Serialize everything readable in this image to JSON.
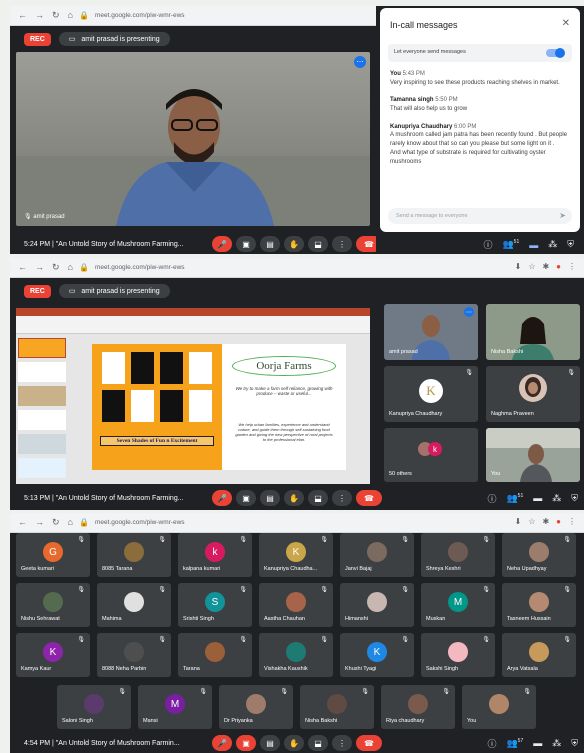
{
  "colors": {
    "meet_dark": "#202124",
    "tile": "#3c4043",
    "rec_red": "#ea4335",
    "accent_blue": "#1a73e8"
  },
  "browser": {
    "url": "meet.google.com/piw-wmr-ews"
  },
  "meet": {
    "rec_label": "REC",
    "presenting_text": "amit prasad is presenting",
    "meeting_title": "\"An Untold Story of Mushroom Farming...",
    "meeting_title_short": "\"An Untold Story of Mushroom Farmin...",
    "panel1": {
      "time": "5:24 PM",
      "speaker_name": "amit prasad",
      "people_count": "51"
    },
    "panel2": {
      "time": "5:13 PM",
      "people_count": "51"
    },
    "panel3": {
      "time": "4:54 PM",
      "people_count": "57"
    }
  },
  "chat": {
    "title": "In-call messages",
    "toggle_label": "Let everyone send messages",
    "input_placeholder": "Send a message to everyone",
    "messages": [
      {
        "sender": "You",
        "time": "5:43 PM",
        "text": "Very inspiring to see these products reaching shelves in market."
      },
      {
        "sender": "Tamanna singh",
        "time": "5:50 PM",
        "text": "That will also help us to grow"
      },
      {
        "sender": "Kanupriya Chaudhary",
        "time": "6:00 PM",
        "text": "A mushroom called jam patra has been recently found . But people rarely know about that so can you please but some light on it ."
      },
      {
        "sender": "",
        "time": "",
        "text": "And what type of substrate is required for cultivating oyster mushrooms"
      }
    ]
  },
  "slide": {
    "brand": "Oorja Farms",
    "tagline": "We try to make a farm self reliance, growing with produce – waste or useful...",
    "body": "We help urban families, experience and understand nature, and guide them through self-sustaining food garden and giving the new perspective of rural projects to the professional elan.",
    "banner": "Seven Shades of Fun n Excitement"
  },
  "side_tiles": [
    {
      "name": "amit prasad",
      "kind": "video"
    },
    {
      "name": "Nisha Bakshi",
      "kind": "video"
    },
    {
      "name": "Kanupriya Chaudhary",
      "kind": "logo",
      "initial": "K"
    },
    {
      "name": "Naghma Praveen",
      "kind": "video"
    },
    {
      "name": "50 others",
      "kind": "others",
      "initial": "k"
    },
    {
      "name": "You",
      "kind": "video"
    }
  ],
  "grid": [
    {
      "name": "Geeta kumari",
      "initial": "G",
      "color": "#e8692e"
    },
    {
      "name": "8085 Tarana",
      "initial": "",
      "color": "#8a6d3b"
    },
    {
      "name": "kalpana kumari",
      "initial": "k",
      "color": "#d81b60"
    },
    {
      "name": "Kanupriya Chaudha...",
      "initial": "K",
      "color": "#c9a64a"
    },
    {
      "name": "Janvi Bajaj",
      "initial": "",
      "color": "#7b6a5f"
    },
    {
      "name": "Shreya Keshri",
      "initial": "",
      "color": "#6d5b53"
    },
    {
      "name": "Neha Upadhyay",
      "initial": "",
      "color": "#9c7c6a"
    },
    {
      "name": "Nishu Sehrawat",
      "initial": "",
      "color": "#556b4f"
    },
    {
      "name": "Mahima",
      "initial": "",
      "color": "#e0e0e0"
    },
    {
      "name": "Srishti Singh",
      "initial": "S",
      "color": "#12939a"
    },
    {
      "name": "Aastha Chauhan",
      "initial": "",
      "color": "#a8644b"
    },
    {
      "name": "Himanshi",
      "initial": "",
      "color": "#c7b7b0"
    },
    {
      "name": "Muskan",
      "initial": "M",
      "color": "#009688"
    },
    {
      "name": "Tasneem Hussain",
      "initial": "",
      "color": "#b68a72"
    },
    {
      "name": "Kamya Kaur",
      "initial": "K",
      "color": "#8e24aa"
    },
    {
      "name": "8088 Neha Parbin",
      "initial": "",
      "color": "#4e4e4e"
    },
    {
      "name": "Tarana",
      "initial": "",
      "color": "#9b5f3a"
    },
    {
      "name": "Vishakha Kaushik",
      "initial": "",
      "color": "#1e7b73"
    },
    {
      "name": "Khushi Tyagi",
      "initial": "K",
      "color": "#1e88e5"
    },
    {
      "name": "Sakshi Singh",
      "initial": "",
      "color": "#f3b8c0"
    },
    {
      "name": "Arya Vatsala",
      "initial": "",
      "color": "#c69a5a"
    },
    {
      "name": "Saloni Singh",
      "initial": "",
      "color": "#5a3b6b"
    },
    {
      "name": "Mansi",
      "initial": "M",
      "color": "#7b1fa2"
    },
    {
      "name": "Dr Priyanka",
      "initial": "",
      "color": "#a07a6a"
    },
    {
      "name": "Nisha Bakshi",
      "initial": "",
      "color": "#5f4b43"
    },
    {
      "name": "Riya chaudhary",
      "initial": "",
      "color": "#7a5a4d"
    },
    {
      "name": "You",
      "initial": "",
      "color": "#b0866a"
    }
  ]
}
